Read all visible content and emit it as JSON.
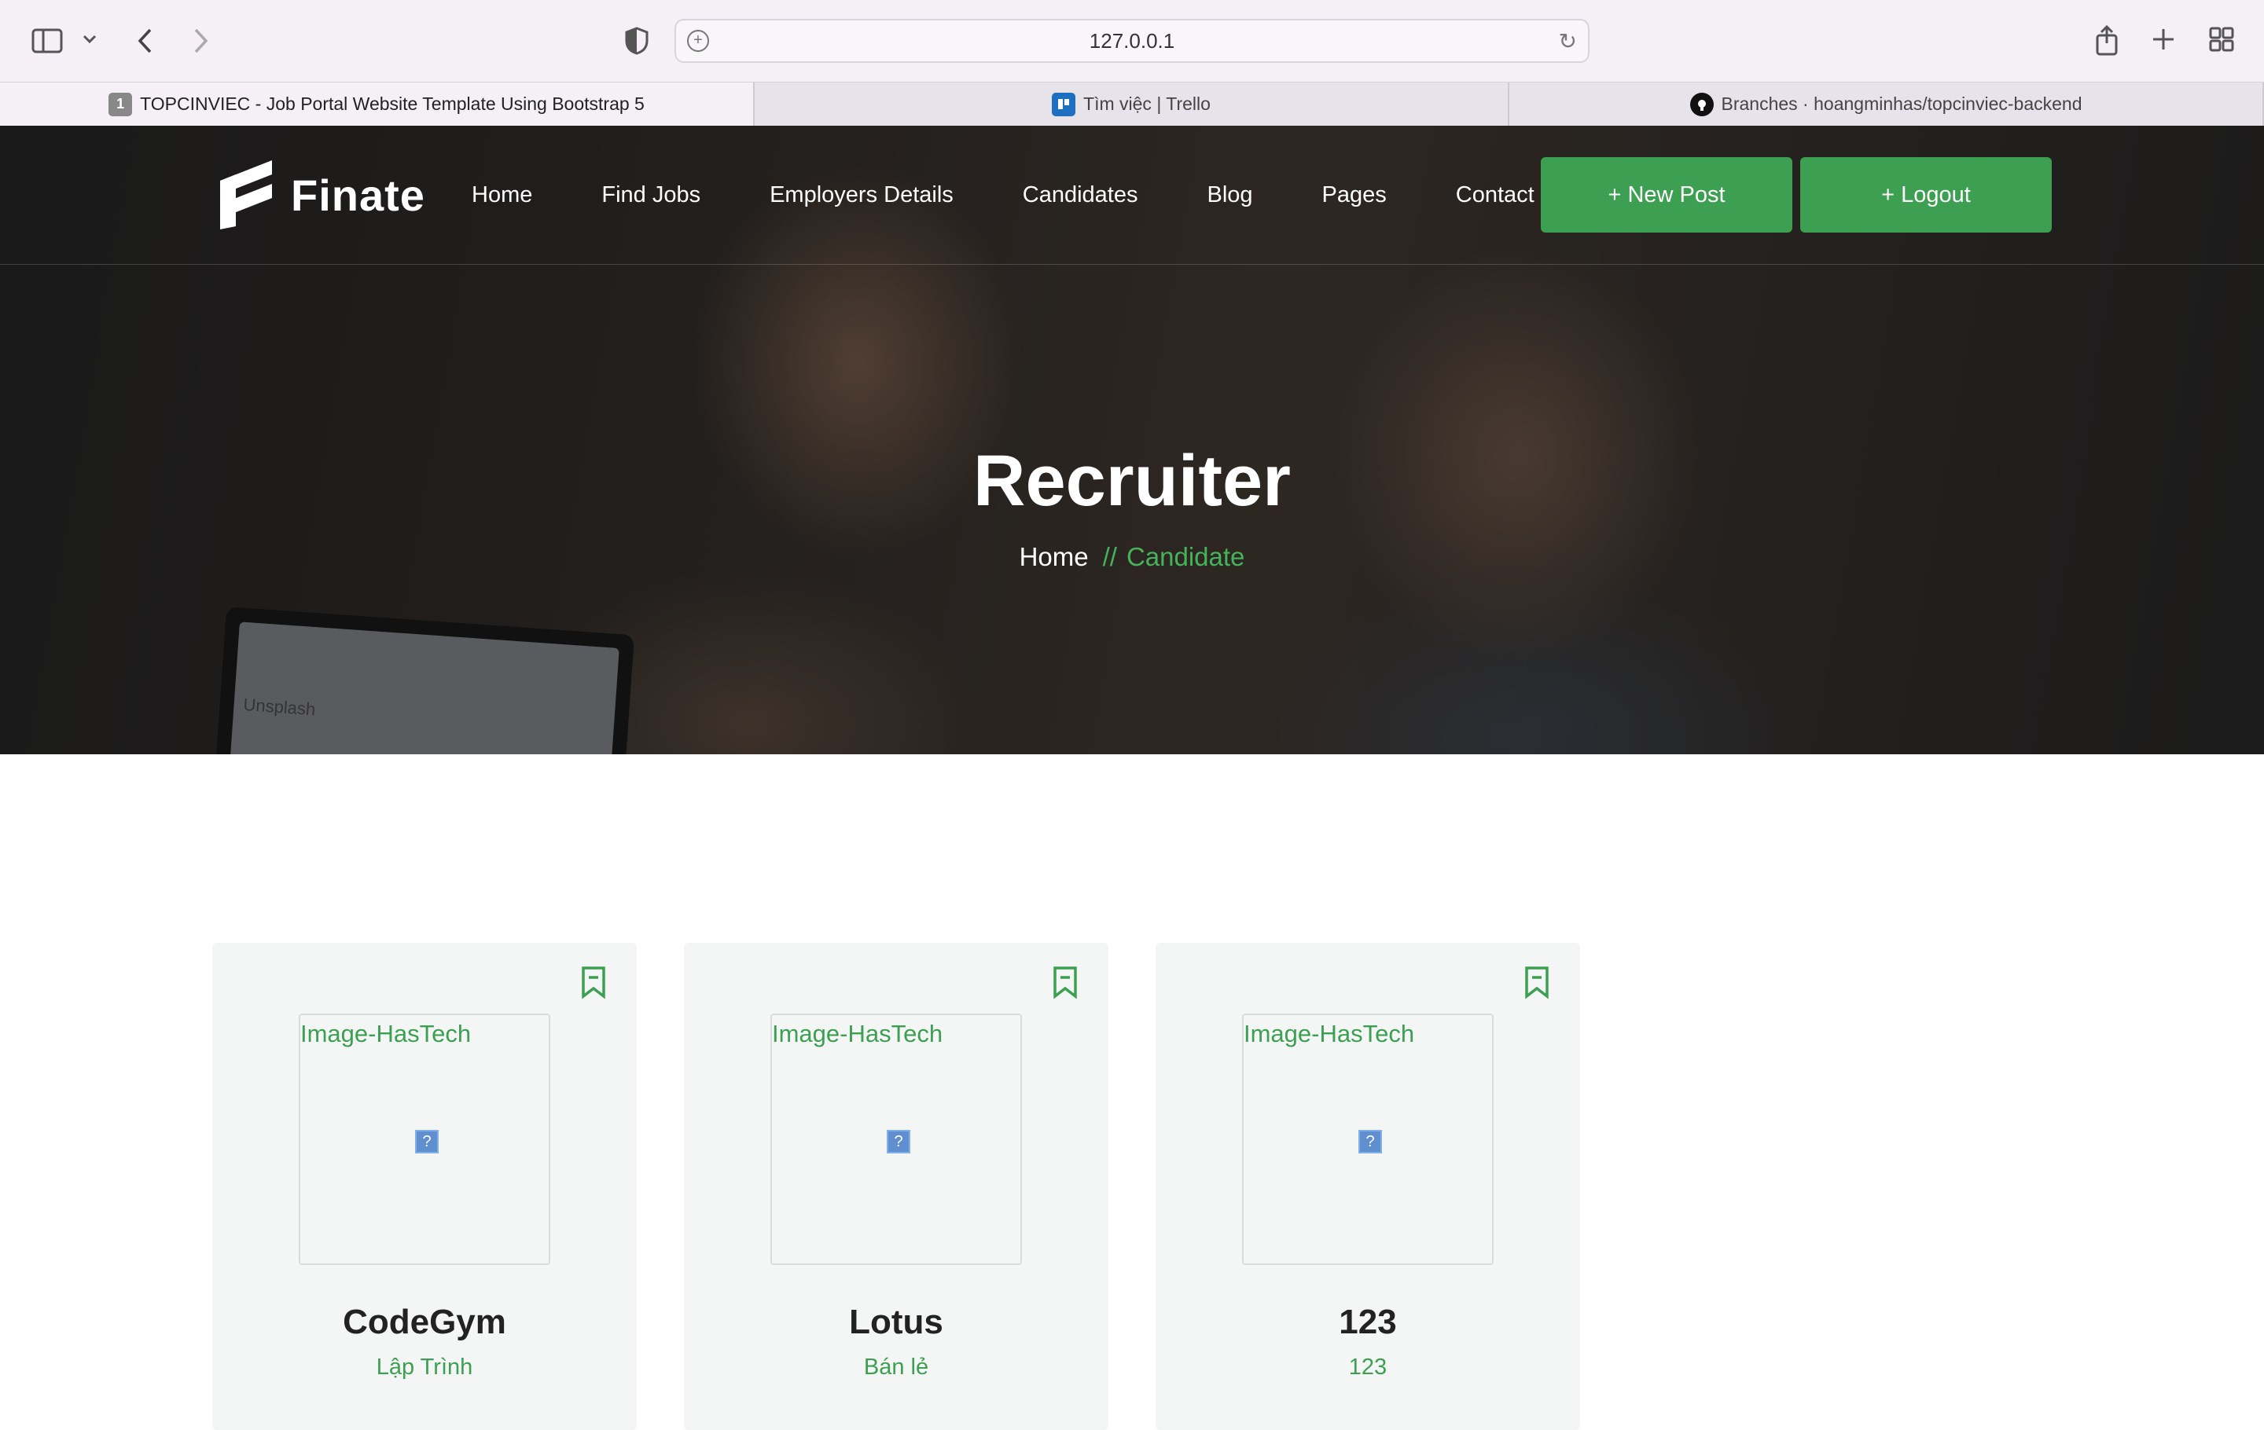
{
  "browser": {
    "url": "127.0.0.1",
    "tabs": [
      {
        "title": "TOPCINVIEC - Job Portal Website Template Using Bootstrap 5",
        "badge": "1"
      },
      {
        "title": "Tìm việc | Trello"
      },
      {
        "title": "Branches · hoangminhas/topcinviec-backend"
      }
    ]
  },
  "site": {
    "logo_text": "Finate",
    "nav": [
      "Home",
      "Find Jobs",
      "Employers Details",
      "Candidates",
      "Blog",
      "Pages",
      "Contact"
    ],
    "new_post_label": "+ New Post",
    "logout_label": "+ Logout",
    "accent_color": "#3d9f52"
  },
  "hero": {
    "title": "Recruiter",
    "breadcrumb_home": "Home",
    "breadcrumb_sep": "//",
    "breadcrumb_current": "Candidate",
    "laptop_text": "Unsplash"
  },
  "cards": [
    {
      "image_alt": "Image-HasTech",
      "name": "CodeGym",
      "category": "Lập Trình"
    },
    {
      "image_alt": "Image-HasTech",
      "name": "Lotus",
      "category": "Bán lẻ"
    },
    {
      "image_alt": "Image-HasTech",
      "name": "123",
      "category": "123"
    }
  ]
}
